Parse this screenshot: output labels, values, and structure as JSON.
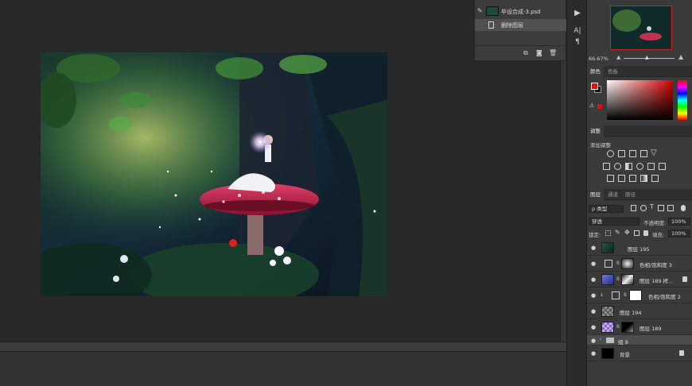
{
  "history": {
    "document_name": "毕设合成-3.psd",
    "item_label": "删除图层"
  },
  "navigator": {
    "zoom": "66.67%"
  },
  "color_panel": {
    "tabs": [
      "颜色",
      "色板"
    ],
    "foreground": "#e01010",
    "background": "#1a1a1a"
  },
  "adjustments_panel": {
    "tab": "调整",
    "label": "添加调整"
  },
  "layers_panel": {
    "tabs": [
      "图层",
      "通道",
      "路径"
    ],
    "filter_label": "ρ 类型",
    "blend_mode": "穿透",
    "opacity_label": "不透明度:",
    "opacity_value": "100%",
    "lock_label": "锁定:",
    "fill_label": "填充:",
    "fill_value": "100%",
    "layers": [
      {
        "name": "图层 195",
        "type": "pixel",
        "visible": true,
        "selected": false
      },
      {
        "name": "色相/饱和度 3",
        "type": "adjustment",
        "visible": true,
        "selected": false
      },
      {
        "name": "图层 189 拷...",
        "type": "pixel",
        "visible": true,
        "selected": false,
        "locked": true
      },
      {
        "name": "色相/饱和度 2",
        "type": "adjustment",
        "visible": true,
        "selected": false
      },
      {
        "name": "图层 194",
        "type": "pixel",
        "visible": true,
        "selected": false
      },
      {
        "name": "图层 189",
        "type": "pixel",
        "visible": true,
        "selected": false
      },
      {
        "name": "组 9",
        "type": "group",
        "visible": true,
        "selected": true
      },
      {
        "name": "背景",
        "type": "background",
        "visible": true,
        "selected": false,
        "locked": true
      }
    ]
  }
}
